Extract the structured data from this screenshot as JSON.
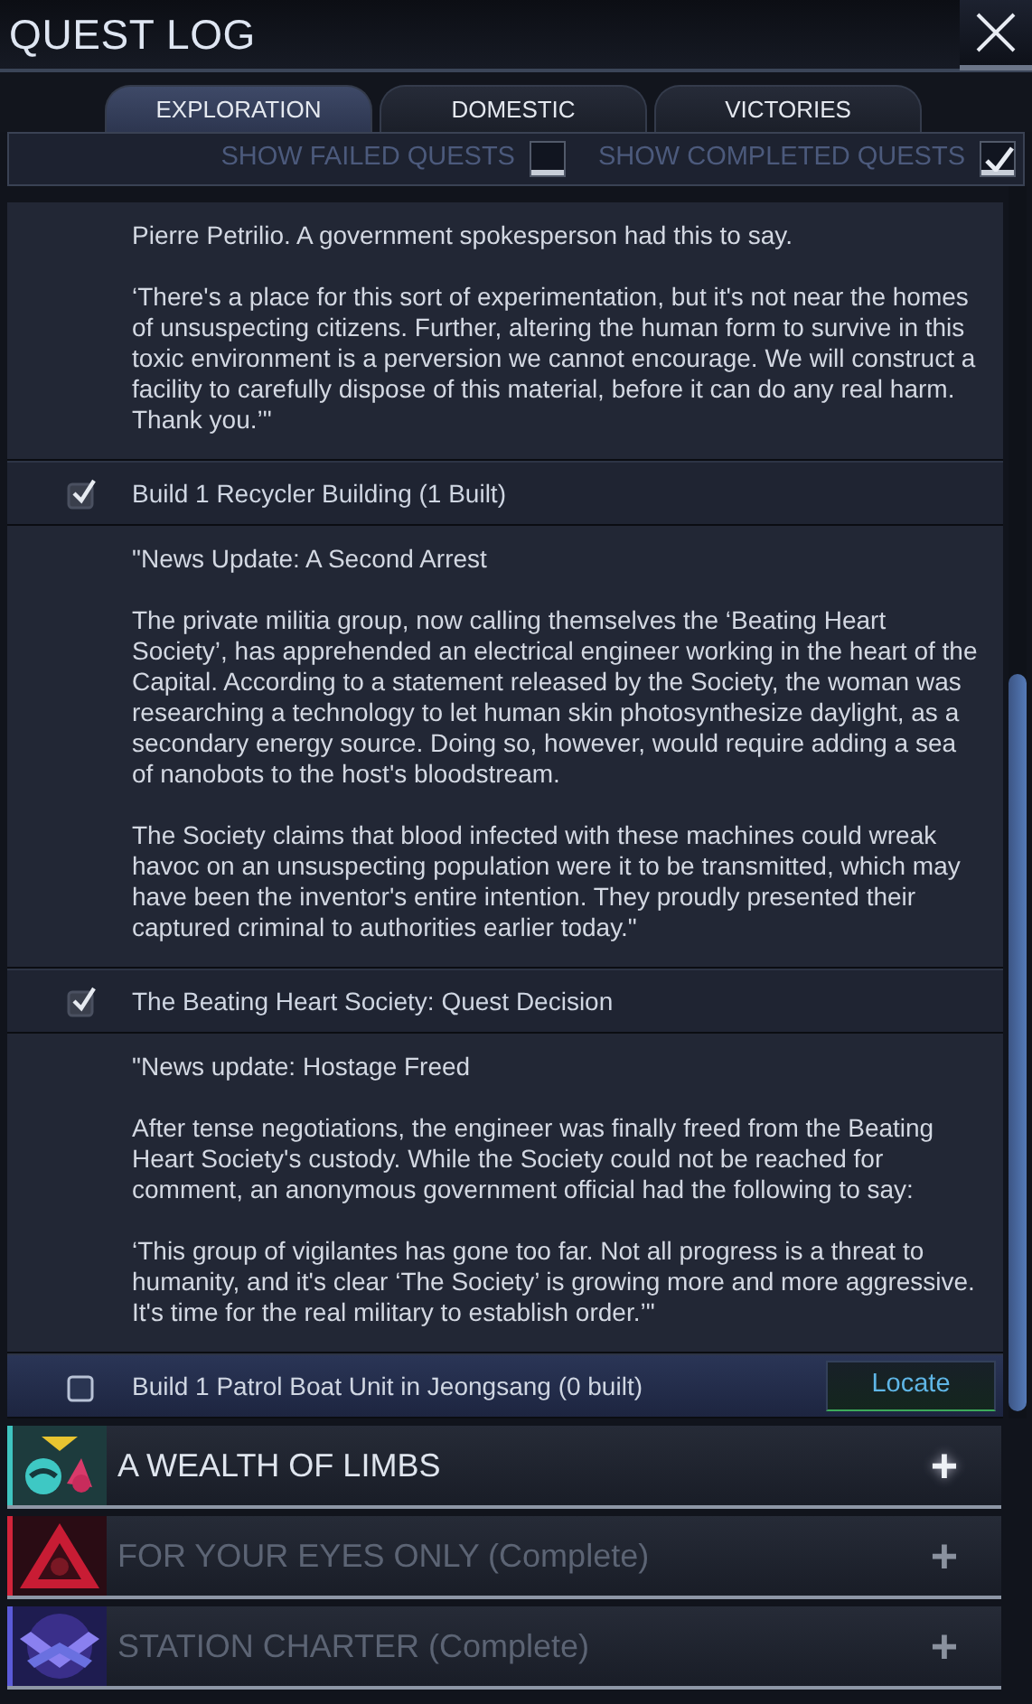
{
  "window": {
    "title": "QUEST LOG"
  },
  "tabs": [
    {
      "label": "EXPLORATION",
      "selected": true
    },
    {
      "label": "DOMESTIC",
      "selected": false
    },
    {
      "label": "VICTORIES",
      "selected": false
    }
  ],
  "filters": [
    {
      "label": "SHOW FAILED QUESTS",
      "checked": false
    },
    {
      "label": "SHOW COMPLETED QUESTS",
      "checked": true
    }
  ],
  "log": [
    {
      "kind": "text",
      "paragraphs": [
        "Pierre Petrilio. A government spokesperson had this to say.",
        "‘There's a place for this sort of experimentation, but it's not near the homes of unsuspecting citizens. Further, altering the human form to survive in this toxic environment is a perversion we cannot encourage. We will construct a facility to carefully dispose of this material, before it can do any real harm. Thank you.’\""
      ]
    },
    {
      "kind": "objective",
      "label": "Build 1 Recycler Building (1 Built)",
      "checked": true
    },
    {
      "kind": "text",
      "paragraphs": [
        "\"News Update: A Second Arrest",
        "The private militia group, now calling themselves the ‘Beating Heart Society’, has apprehended an electrical engineer working in the heart of the Capital. According to a statement released by the Society, the woman was researching a technology to let human skin photosynthesize daylight, as a secondary energy source. Doing so, however, would require adding a sea of nanobots to the host's bloodstream.",
        "The Society claims that blood infected with these machines could wreak havoc on an unsuspecting population were it to be transmitted, which may have been the inventor's entire intention. They proudly presented their captured criminal to authorities earlier today.\""
      ]
    },
    {
      "kind": "objective",
      "label": "The Beating Heart Society: Quest Decision",
      "checked": true
    },
    {
      "kind": "text",
      "paragraphs": [
        "\"News update: Hostage Freed",
        "After tense negotiations, the engineer was finally freed from the Beating Heart Society's custody. While the Society could not be reached for comment, an anonymous government official had the following to say:",
        "‘This group of vigilantes has gone too far. Not all progress is a threat to humanity, and it's clear ‘The Society’ is growing more and more aggressive. It's time for the real military to establish order.’\""
      ]
    },
    {
      "kind": "objective",
      "label": "Build 1 Patrol Boat Unit in Jeongsang (0 built)",
      "checked": false,
      "button": "Locate"
    }
  ],
  "quests": [
    {
      "name": "A WEALTH OF LIMBS",
      "complete": false,
      "color": "#3fc4c0",
      "expand": "+"
    },
    {
      "name": "FOR YOUR EYES ONLY (Complete)",
      "complete": true,
      "color": "#d2243a",
      "expand": "+"
    },
    {
      "name": "STATION CHARTER (Complete)",
      "complete": true,
      "color": "#5a5ad8",
      "expand": "+"
    }
  ]
}
